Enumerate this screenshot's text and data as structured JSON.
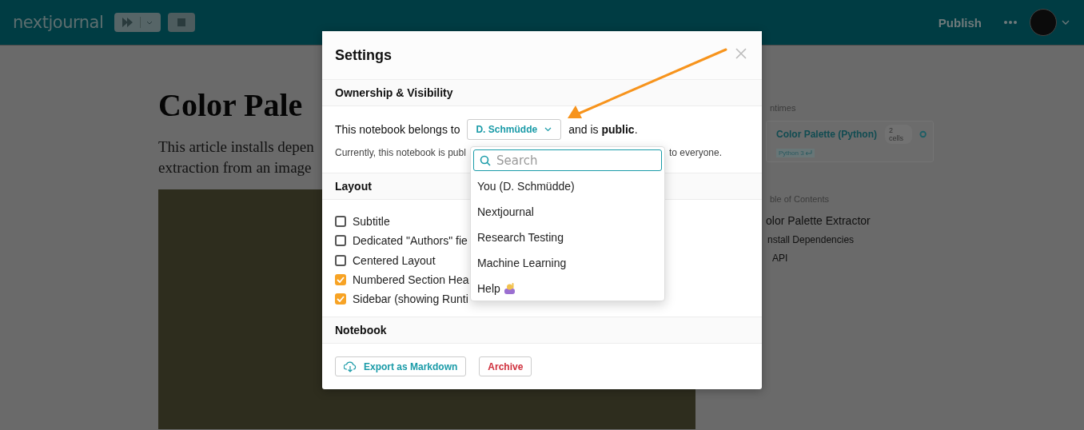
{
  "topbar": {
    "logo": "nextjournal",
    "publish": "Publish"
  },
  "article": {
    "title": "Color Pale",
    "intro_lines": [
      "This article installs depen",
      "extraction from an image"
    ]
  },
  "sidebar": {
    "runtimes_heading": "ntimes",
    "runtime": {
      "name": "Color Palette (Python)",
      "cells": "2 cells",
      "language": "Python 3"
    },
    "toc_heading": "ble of Contents",
    "toc": [
      {
        "label": "olor Palette Extractor",
        "children": [
          {
            "label": "nstall Dependencies"
          },
          {
            "label": "API"
          }
        ]
      }
    ]
  },
  "settings": {
    "title": "Settings",
    "ownership": {
      "heading": "Ownership & Visibility",
      "sentence_before": "This notebook belongs to",
      "owner": "D. Schmüdde",
      "sentence_after": "and is **public**.",
      "note_start": "Currently, this notebook is publ",
      "note_end": "to everyone."
    },
    "layout": {
      "heading": "Layout",
      "options": [
        {
          "label": "Subtitle",
          "checked": false
        },
        {
          "label": "Dedicated \"Authors\" fie",
          "checked": false
        },
        {
          "label": "Centered Layout",
          "checked": false
        },
        {
          "label": "Numbered Section Hea",
          "checked": true
        },
        {
          "label": "Sidebar (showing Runti",
          "checked": true
        }
      ]
    },
    "notebook": {
      "heading": "Notebook",
      "actions": [
        {
          "label": "Export as Markdown",
          "kind": "export"
        },
        {
          "label": "Archive",
          "kind": "danger"
        }
      ]
    }
  },
  "owner_dropdown": {
    "placeholder": "Search",
    "options": [
      {
        "label": "You (D. Schmüdde)",
        "kind": "plain"
      },
      {
        "label": "Nextjournal",
        "kind": "plain"
      },
      {
        "label": "Research Testing",
        "kind": "plain"
      },
      {
        "label": "Machine Learning",
        "kind": "plain"
      },
      {
        "label": "Help",
        "kind": "help"
      }
    ]
  }
}
